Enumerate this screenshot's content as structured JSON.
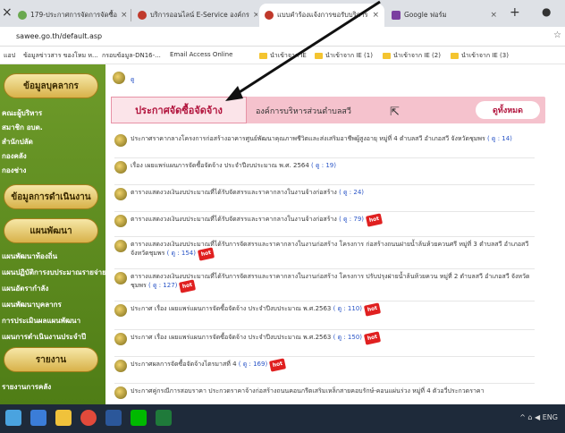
{
  "browser": {
    "tabs": [
      {
        "label": "179-ประกาศการจัดการจัดซื้อ",
        "active": false
      },
      {
        "label": "บริการออนไลน์ E-Service องค์กร",
        "active": false
      },
      {
        "label": "แบบคำร้องแจ้งการขอรับบริการ",
        "active": true
      },
      {
        "label": "Google ฟอร์ม",
        "active": false
      }
    ],
    "new_tab": "+",
    "url": "sawee.go.th/default.asp",
    "bookmarks": [
      "แอป",
      "ข้อมูลข่าวสาร ของโหม ห...",
      "กรอบข้อมูล-DN16-...",
      "Email Access Online",
      "นำเข้าจาก IE",
      "นำเข้าจาก IE (1)",
      "นำเข้าจาก IE (2)",
      "นำเข้าจาก IE (3)"
    ]
  },
  "sidebar": {
    "sections": [
      {
        "heading": "ข้อมูลบุคลากร",
        "links": [
          "คณะผู้บริหาร",
          "สมาชิก อบต.",
          "สำนักปลัด",
          "กองคลัง",
          "กองช่าง"
        ]
      },
      {
        "heading": "ข้อมูลการดำเนินงาน",
        "links": []
      },
      {
        "heading": "แผนพัฒนา",
        "links": [
          "แผนพัฒนาท้องถิ่น",
          "แผนปฏิบัติการงบประมาณรายจ่าย",
          "แผนอัตรากำลัง",
          "แผนพัฒนาบุคลากร",
          "การประเมินผลแผนพัฒนา",
          "แผนการดำเนินงานประจำปี"
        ]
      },
      {
        "heading": "รายงาน",
        "links": [
          "รายงานการคลัง"
        ]
      }
    ]
  },
  "main": {
    "top_link": "ดู",
    "tab_active": "ประกาศจัดซื้อจัดจ้าง",
    "tab_other": "องค์การบริหารส่วนตำบลสวี",
    "view_all": "ดูทั้งหมด",
    "items": [
      {
        "text": "ประกาศราคากลางโครงการก่อสร้างอาคารศูนย์พัฒนาคุณภาพชีวิตและส่งเสริมอาชีพผู้สูงอายุ หมู่ที่ 4 ตำบลสวี อำเภอสวี จังหวัดชุมพร",
        "count": "( ดู : 14)",
        "hot": false
      },
      {
        "text": "เรื่อง เผยแพร่แผนการจัดซื้อจัดจ้าง ประจำปีงบประมาณ พ.ศ. 2564",
        "count": "( ดู : 19)",
        "hot": false
      },
      {
        "text": "ตารางแสดงวงเงินงบประมาณที่ได้รับจัดสรรและราคากลางในงานจ้างก่อสร้าง",
        "count": "( ดู : 24)",
        "hot": false
      },
      {
        "text": "ตารางแสดงวงเงินงบประมาณที่ได้รับจัดสรรและราคากลางในงานจ้างก่อสร้าง",
        "count": "( ดู : 79)",
        "hot": true
      },
      {
        "text": "ตารางแสดงวงเงินงบประมาณที่ได้รับการจัดสรรและราคากลางในงานก่อสร้าง โครงการ ก่อสร้างถนนฝายน้ำล้นห้วยควนศรี หมู่ที่ 3 ตำบลสวี อำเภอสวี จังหวัดชุมพร",
        "count": "( ดู : 154)",
        "hot": true
      },
      {
        "text": "ตารางแสดงวงเงินงบประมาณที่ได้รับการจัดสรรและราคากลางในงานก่อสร้าง โครงการ ปรับปรุงฝายน้ำล้นห้วยควน หมู่ที่ 2 ตำบลสวี อำเภอสวี จังหวัดชุมพร",
        "count": "( ดู : 127)",
        "hot": true
      },
      {
        "text": "ประกาศ เรื่อง เผยแพร่แผนการจัดซื้อจัดจ้าง ประจำปีงบประมาณ พ.ศ.2563",
        "count": "( ดู : 110)",
        "hot": true
      },
      {
        "text": "ประกาศ เรื่อง เผยแพร่แผนการจัดซื้อจัดจ้าง ประจำปีงบประมาณ พ.ศ.2563",
        "count": "( ดู : 150)",
        "hot": true
      },
      {
        "text": "ประกาศผลการจัดซื้อจัดจ้างไตรมาสที่ 4",
        "count": "( ดู : 169)",
        "hot": true
      },
      {
        "text": "ประกาศคู่กรณีการสอบราคา ประกวดราคาจ้างก่อสร้างถนนคอนกรีตเสริมเหล็กสายคอบรักษ์-คอนแผ่นร่วง หมู่ที่ 4 ตัวอวี่ประกวดราคา",
        "count": "",
        "hot": false
      }
    ],
    "hot_label": "hot"
  },
  "taskbar": {
    "tray": "^ ⌂ ◀ ENG"
  }
}
